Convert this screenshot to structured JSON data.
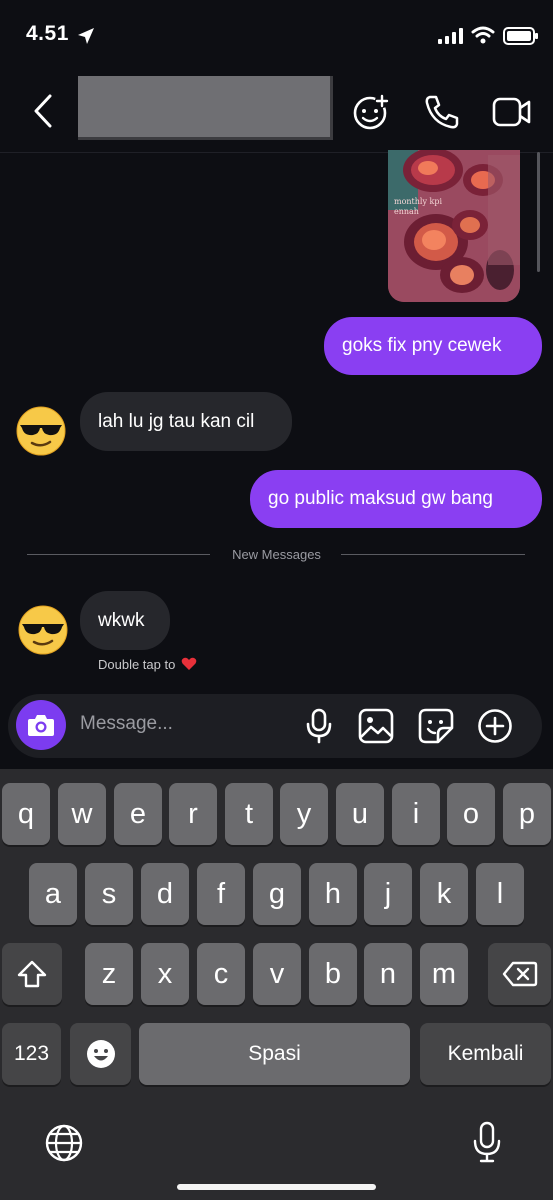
{
  "status_bar": {
    "time": "4.51"
  },
  "header": {
    "back_icon": "chevron-left-icon",
    "actions": [
      "emoji-add-icon",
      "phone-icon",
      "video-camera-icon"
    ]
  },
  "shared_photo": {
    "caption_line1": "monthly kpi",
    "caption_line2": "ennah"
  },
  "messages": [
    {
      "direction": "outgoing",
      "text": "goks fix pny cewek"
    },
    {
      "direction": "incoming",
      "text": "lah lu jg tau kan cil"
    },
    {
      "direction": "outgoing",
      "text": "go public maksud gw bang"
    },
    {
      "direction": "incoming",
      "text": "wkwk"
    }
  ],
  "divider": {
    "label": "New Messages"
  },
  "hint": {
    "text": "Double tap to",
    "icon": "heart-icon"
  },
  "composer": {
    "placeholder": "Message...",
    "icons": [
      "camera-icon",
      "microphone-icon",
      "gallery-icon",
      "sticker-icon",
      "plus-circle-icon"
    ]
  },
  "keyboard": {
    "row1": [
      "q",
      "w",
      "e",
      "r",
      "t",
      "y",
      "u",
      "i",
      "o",
      "p"
    ],
    "row2": [
      "a",
      "s",
      "d",
      "f",
      "g",
      "h",
      "j",
      "k",
      "l"
    ],
    "row3": [
      "z",
      "x",
      "c",
      "v",
      "b",
      "n",
      "m"
    ],
    "numbers_key": "123",
    "space_key": "Spasi",
    "return_key": "Kembali",
    "icons": [
      "shift-icon",
      "backspace-icon",
      "emoji-icon",
      "globe-icon",
      "dictation-icon"
    ]
  },
  "colors": {
    "background": "#0d0e13",
    "outgoing_bubble": "#8a3ff2",
    "incoming_bubble": "#26272c",
    "camera_button": "#7c3cf0"
  }
}
